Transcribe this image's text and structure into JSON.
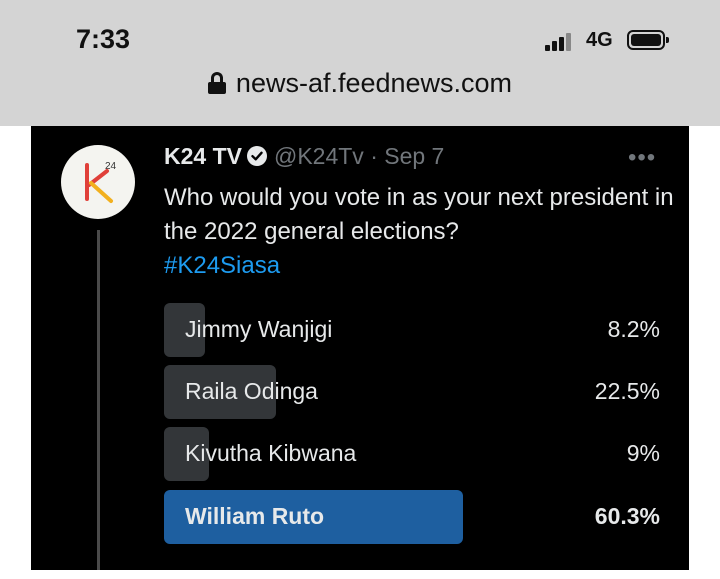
{
  "status_bar": {
    "time": "7:33",
    "network": "4G",
    "signal_icon": "signal-bars-icon",
    "battery_icon": "battery-icon"
  },
  "browser": {
    "url": "news-af.feednews.com",
    "lock_icon": "lock-icon"
  },
  "tweet": {
    "author_name": "K24 TV",
    "verified": true,
    "handle_date": "@K24Tv · Sep 7",
    "more_label": "•••",
    "text": "Who would you vote in as your next president in the 2022 general elections?",
    "hashtag": "#K24Siasa",
    "avatar_mark": "K",
    "avatar_superscript": "24",
    "poll": {
      "options": [
        {
          "label": "Jimmy Wanjigi",
          "percent_text": "8.2%",
          "percent": 8.2,
          "winner": false
        },
        {
          "label": "Raila Odinga",
          "percent_text": "22.5%",
          "percent": 22.5,
          "winner": false
        },
        {
          "label": "Kivutha Kibwana",
          "percent_text": "9%",
          "percent": 9,
          "winner": false
        },
        {
          "label": "William Ruto",
          "percent_text": "60.3%",
          "percent": 60.3,
          "winner": true
        }
      ]
    }
  },
  "colors": {
    "background": "#000000",
    "text": "#e7e9ea",
    "muted": "#71767b",
    "hashtag": "#1d9bf0",
    "poll_bar": "#333639",
    "poll_winner_bar": "#1e5fa0",
    "avatar_red": "#e0403a",
    "avatar_yellow": "#f2b01e"
  }
}
